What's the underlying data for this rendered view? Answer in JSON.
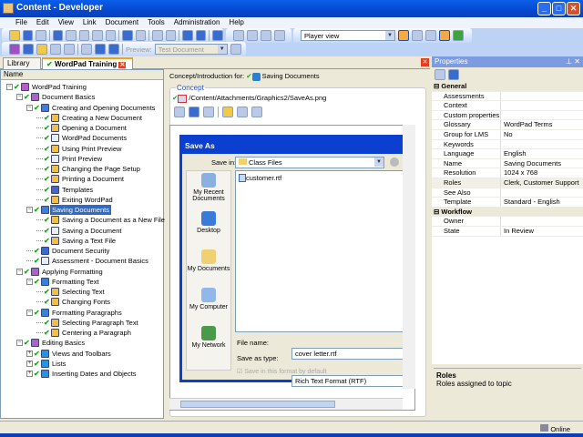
{
  "window": {
    "title": "Content - Developer",
    "minimize": "_",
    "maximize": "□",
    "close": "✕"
  },
  "menu": [
    "File",
    "Edit",
    "View",
    "Link",
    "Document",
    "Tools",
    "Administration",
    "Help"
  ],
  "toolbar": {
    "preview_label": "Preview:",
    "preview_value": "Test Document",
    "view_value": "Player view"
  },
  "tabs": [
    {
      "label": "Library"
    },
    {
      "label": "WordPad Training"
    }
  ],
  "tree": {
    "header": "Name",
    "items": [
      {
        "l": 0,
        "t": "WordPad Training",
        "e": "-",
        "i": "course"
      },
      {
        "l": 1,
        "t": "Document Basics",
        "e": "-",
        "i": "course"
      },
      {
        "l": 2,
        "t": "Creating and Opening Documents",
        "e": "-",
        "i": "book"
      },
      {
        "l": 3,
        "t": "Creating a New Document",
        "i": "topic"
      },
      {
        "l": 3,
        "t": "Opening a Document",
        "i": "topic"
      },
      {
        "l": 3,
        "t": "WordPad Documents",
        "i": "help"
      },
      {
        "l": 3,
        "t": "Using Print Preview",
        "i": "topic"
      },
      {
        "l": 3,
        "t": "Print Preview",
        "i": "help"
      },
      {
        "l": 3,
        "t": "Changing the Page Setup",
        "i": "topic"
      },
      {
        "l": 3,
        "t": "Printing a Document",
        "i": "topic"
      },
      {
        "l": 3,
        "t": "Templates",
        "i": "doc"
      },
      {
        "l": 3,
        "t": "Exiting WordPad",
        "i": "topic"
      },
      {
        "l": 2,
        "t": "Saving Documents",
        "e": "-",
        "i": "book",
        "sel": true
      },
      {
        "l": 3,
        "t": "Saving a Document as a New File",
        "i": "topic"
      },
      {
        "l": 3,
        "t": "Saving a Document",
        "i": "help"
      },
      {
        "l": 3,
        "t": "Saving a Text File",
        "i": "topic"
      },
      {
        "l": 2,
        "t": "Document Security",
        "i": "doc"
      },
      {
        "l": 2,
        "t": "Assessment - Document Basics",
        "i": "help"
      },
      {
        "l": 1,
        "t": "Applying Formatting",
        "e": "-",
        "i": "course"
      },
      {
        "l": 2,
        "t": "Formatting Text",
        "e": "-",
        "i": "book"
      },
      {
        "l": 3,
        "t": "Selecting Text",
        "i": "topic"
      },
      {
        "l": 3,
        "t": "Changing Fonts",
        "i": "topic"
      },
      {
        "l": 2,
        "t": "Formatting Paragraphs",
        "e": "-",
        "i": "book"
      },
      {
        "l": 3,
        "t": "Selecting Paragraph Text",
        "i": "topic"
      },
      {
        "l": 3,
        "t": "Centering a Paragraph",
        "i": "topic"
      },
      {
        "l": 1,
        "t": "Editing Basics",
        "e": "-",
        "i": "course"
      },
      {
        "l": 2,
        "t": "Views and Toolbars",
        "e": "+",
        "i": "bluebook"
      },
      {
        "l": 2,
        "t": "Lists",
        "e": "+",
        "i": "bluebook"
      },
      {
        "l": 2,
        "t": "Inserting Dates and Objects",
        "e": "+",
        "i": "bluebook"
      }
    ]
  },
  "content": {
    "for_label": "Concept/Introduction for:",
    "for_value": "Saving Documents",
    "group": "Concept",
    "path": "/Content/Attachments/Graphics2/SaveAs.png"
  },
  "dialog": {
    "title": "Save As",
    "save_in_label": "Save in:",
    "save_in_value": "Class Files",
    "places": [
      "My Recent Documents",
      "Desktop",
      "My Documents",
      "My Computer",
      "My Network"
    ],
    "files": [
      "customer.rtf"
    ],
    "file_name_label": "File name:",
    "file_name_value": "cover letter.rtf",
    "type_label": "Save as type:",
    "type_value": "Rich Text Format (RTF)",
    "default_check": "Save in this format by default"
  },
  "properties": {
    "title": "Properties",
    "pin": "⊥",
    "close": "✕",
    "rows": [
      {
        "cat": "General"
      },
      {
        "k": "Assessments",
        "v": ""
      },
      {
        "k": "Context",
        "v": ""
      },
      {
        "k": "Custom properties",
        "v": ""
      },
      {
        "k": "Glossary",
        "v": "WordPad Terms"
      },
      {
        "k": "Group for LMS",
        "v": "No"
      },
      {
        "k": "Keywords",
        "v": ""
      },
      {
        "k": "Language",
        "v": "English"
      },
      {
        "k": "Name",
        "v": "Saving Documents"
      },
      {
        "k": "Resolution",
        "v": "1024 x 768"
      },
      {
        "k": "Roles",
        "v": "Clerk, Customer Support",
        "hl": true
      },
      {
        "k": "See Also",
        "v": ""
      },
      {
        "k": "Template",
        "v": "Standard - English"
      },
      {
        "cat": "Workflow"
      },
      {
        "k": "Owner",
        "v": ""
      },
      {
        "k": "State",
        "v": "In Review"
      }
    ],
    "desc_title": "Roles",
    "desc_text": "Roles assigned to topic"
  },
  "status": {
    "text": "Online"
  }
}
